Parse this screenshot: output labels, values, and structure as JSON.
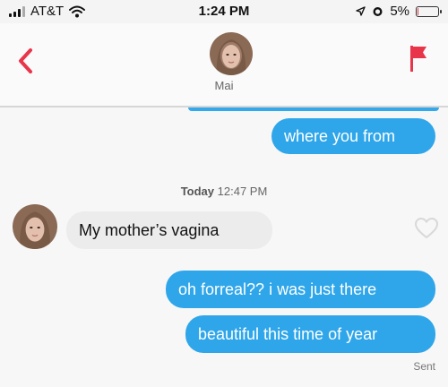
{
  "status_bar": {
    "carrier": "AT&T",
    "time": "1:24 PM",
    "battery": "5%",
    "battery_level": 0.05,
    "icons": [
      "signal-icon",
      "wifi-icon",
      "location-arrow-icon",
      "alarm-icon",
      "battery-icon"
    ]
  },
  "header": {
    "contact_name": "Mai",
    "icons": [
      "back-chevron-icon",
      "report-flag-icon",
      "avatar"
    ]
  },
  "conversation": {
    "date_day": "Today",
    "date_time": "12:47 PM",
    "messages": [
      {
        "from": "me",
        "text": "where you from"
      },
      {
        "from": "them",
        "text": "My mother’s vagina"
      },
      {
        "from": "me",
        "text": "oh forreal?? i was just there"
      },
      {
        "from": "me",
        "text": "beautiful this time of year"
      }
    ],
    "receipt": "Sent"
  },
  "colors": {
    "outgoing_bubble": "#2fa6ea",
    "incoming_bubble": "#ececec",
    "accent_red": "#e8354a",
    "background": "#f7f7f7"
  }
}
